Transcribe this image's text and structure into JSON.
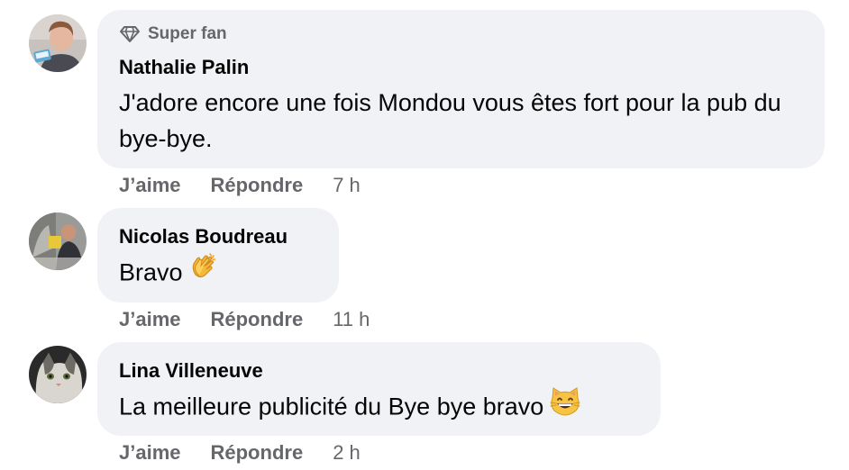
{
  "comments": [
    {
      "badge": "Super fan",
      "author": "Nathalie Palin",
      "text": "J'adore encore une fois Mondou vous êtes fort pour la pub du bye-bye.",
      "like_label": "J’aime",
      "reply_label": "Répondre",
      "time": "7 h"
    },
    {
      "author": "Nicolas Boudreau",
      "text": "Bravo",
      "emoji": "clapping-hands-icon",
      "like_label": "J’aime",
      "reply_label": "Répondre",
      "time": "11 h"
    },
    {
      "author": "Lina Villeneuve",
      "text": "La meilleure publicité du Bye bye bravo",
      "emoji": "grinning-cat-icon",
      "like_label": "J’aime",
      "reply_label": "Répondre",
      "time": "2 h"
    }
  ],
  "colors": {
    "bubble": "#f0f2f5",
    "secondary_text": "#65676b",
    "primary_text": "#050505"
  }
}
